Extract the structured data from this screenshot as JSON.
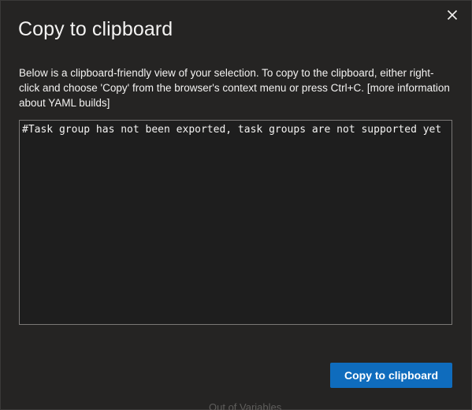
{
  "dialog": {
    "title": "Copy to clipboard",
    "close_icon": "close-icon",
    "description": "Below is a clipboard-friendly view of your selection. To copy to the clipboard, either right-click and choose 'Copy' from the browser's context menu or press Ctrl+C.",
    "more_info_link": "[more information about YAML builds]",
    "yaml_text": "#Task group has not been exported, task groups are not supported yet",
    "copy_button_label": "Copy to clipboard"
  },
  "background": {
    "partial_text": "Out of Variables"
  },
  "colors": {
    "dialog_bg": "#252423",
    "accent": "#0f6cbd",
    "text": "#f3f2f1",
    "border": "#7a7876"
  }
}
